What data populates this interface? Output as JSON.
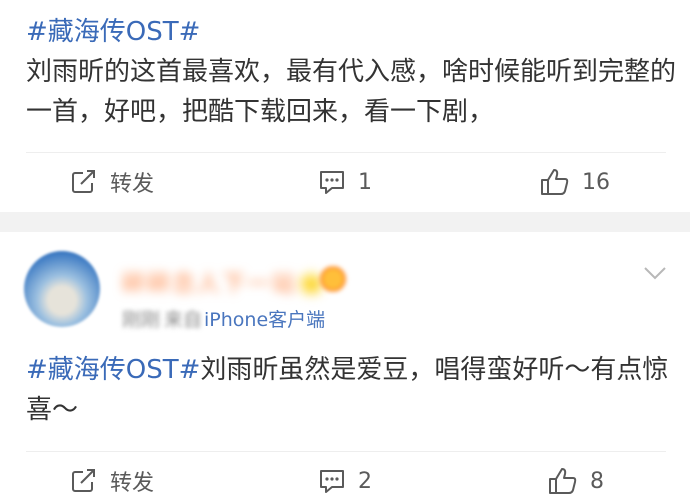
{
  "posts": [
    {
      "hashtag": "#藏海传OST#",
      "text": "刘雨昕的这首最喜欢，最有代入感，啥时候能听到完整的一首，好吧，把酷下载回来，看一下剧，",
      "actions": {
        "repost_label": "转发",
        "comment_count": "1",
        "like_count": "16"
      }
    },
    {
      "author": {
        "name": "碎碎念人下一站🌟",
        "time": "刚刚",
        "via": "来自",
        "client": "iPhone客户端"
      },
      "hashtag": "#藏海传OST#",
      "text": "刘雨昕虽然是爱豆，唱得蛮好听～有点惊喜～",
      "actions": {
        "repost_label": "转发",
        "comment_count": "2",
        "like_count": "8"
      }
    }
  ],
  "colors": {
    "hashtag": "#3a6ab8",
    "body_text": "#333333",
    "action_text": "#5a5a5a",
    "meta_text": "#8a8a8a",
    "client_link": "#4a76be",
    "section_gap": "#f2f2f2"
  },
  "icons": {
    "repost": "share-square-icon",
    "comment": "speech-bubble-icon",
    "like": "thumbs-up-icon",
    "menu": "chevron-down-icon"
  }
}
